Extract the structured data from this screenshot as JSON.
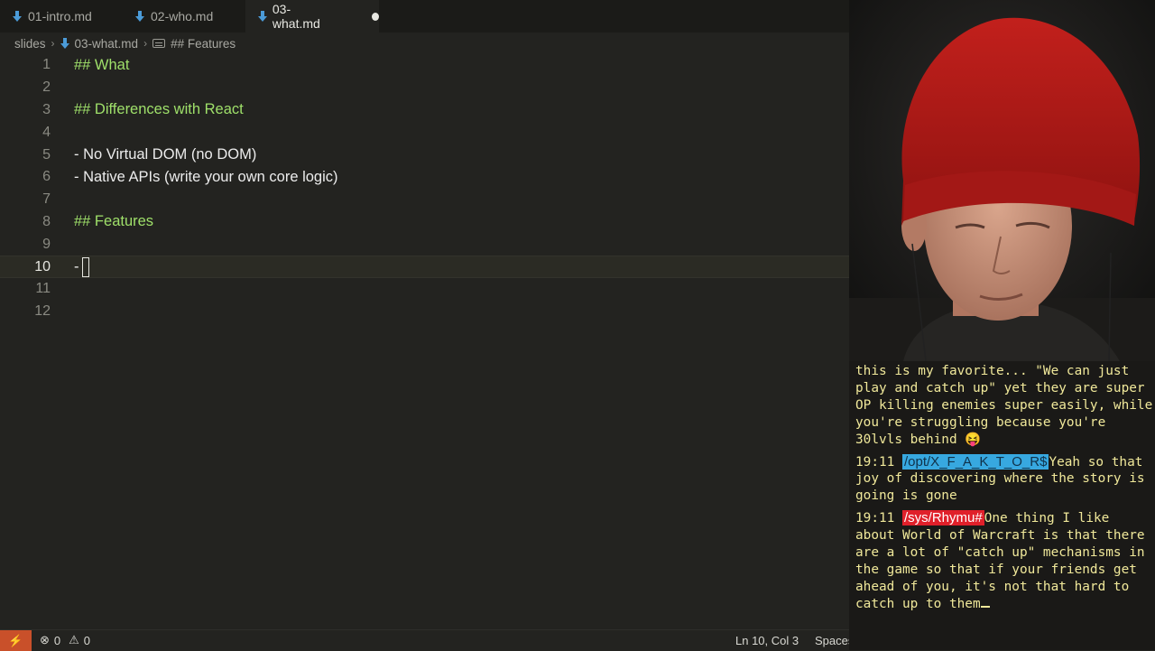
{
  "tabs": [
    {
      "label": "01-intro.md",
      "active": false
    },
    {
      "label": "02-who.md",
      "active": false
    },
    {
      "label": "03-what.md",
      "active": true
    }
  ],
  "breadcrumb": {
    "folder": "slides",
    "file": "03-what.md",
    "symbol": "## Features"
  },
  "lines": [
    {
      "num": "1",
      "text": "## What"
    },
    {
      "num": "2",
      "text": ""
    },
    {
      "num": "3",
      "text": "## Differences with React"
    },
    {
      "num": "4",
      "text": ""
    },
    {
      "num": "5",
      "text": "- No Virtual DOM (no DOM)"
    },
    {
      "num": "6",
      "text": "- Native APIs (write your own core logic)"
    },
    {
      "num": "7",
      "text": ""
    },
    {
      "num": "8",
      "text": "## Features"
    },
    {
      "num": "9",
      "text": ""
    },
    {
      "num": "10",
      "text": "-"
    },
    {
      "num": "11",
      "text": ""
    },
    {
      "num": "12",
      "text": ""
    }
  ],
  "statusbar": {
    "errors": "0",
    "warnings": "0",
    "position": "Ln 10, Col 3",
    "indent": "Spaces"
  },
  "chat": {
    "first_message": "this is my favorite... \"We can just play and catch up\" yet they are super OP killing enemies super easily, while you're struggling because you're 30lvls behind",
    "first_emoji": "😝",
    "messages": [
      {
        "time": "19:11",
        "user": "/opt/X_F_A_K_T_O_R$",
        "text": "Yeah so that joy of discovering where the story is going is gone"
      },
      {
        "time": "19:11",
        "user": "/sys/Rhymu#",
        "text": "One thing I like about World of Warcraft is that there are a lot of \"catch up\" mechanisms in the game so that if your friends get ahead of you, it's not that hard to catch up to them"
      }
    ]
  },
  "colors": {
    "heading": "#9fe06a",
    "accent_remote": "#c9502a",
    "chat_text": "#f0e89a"
  }
}
